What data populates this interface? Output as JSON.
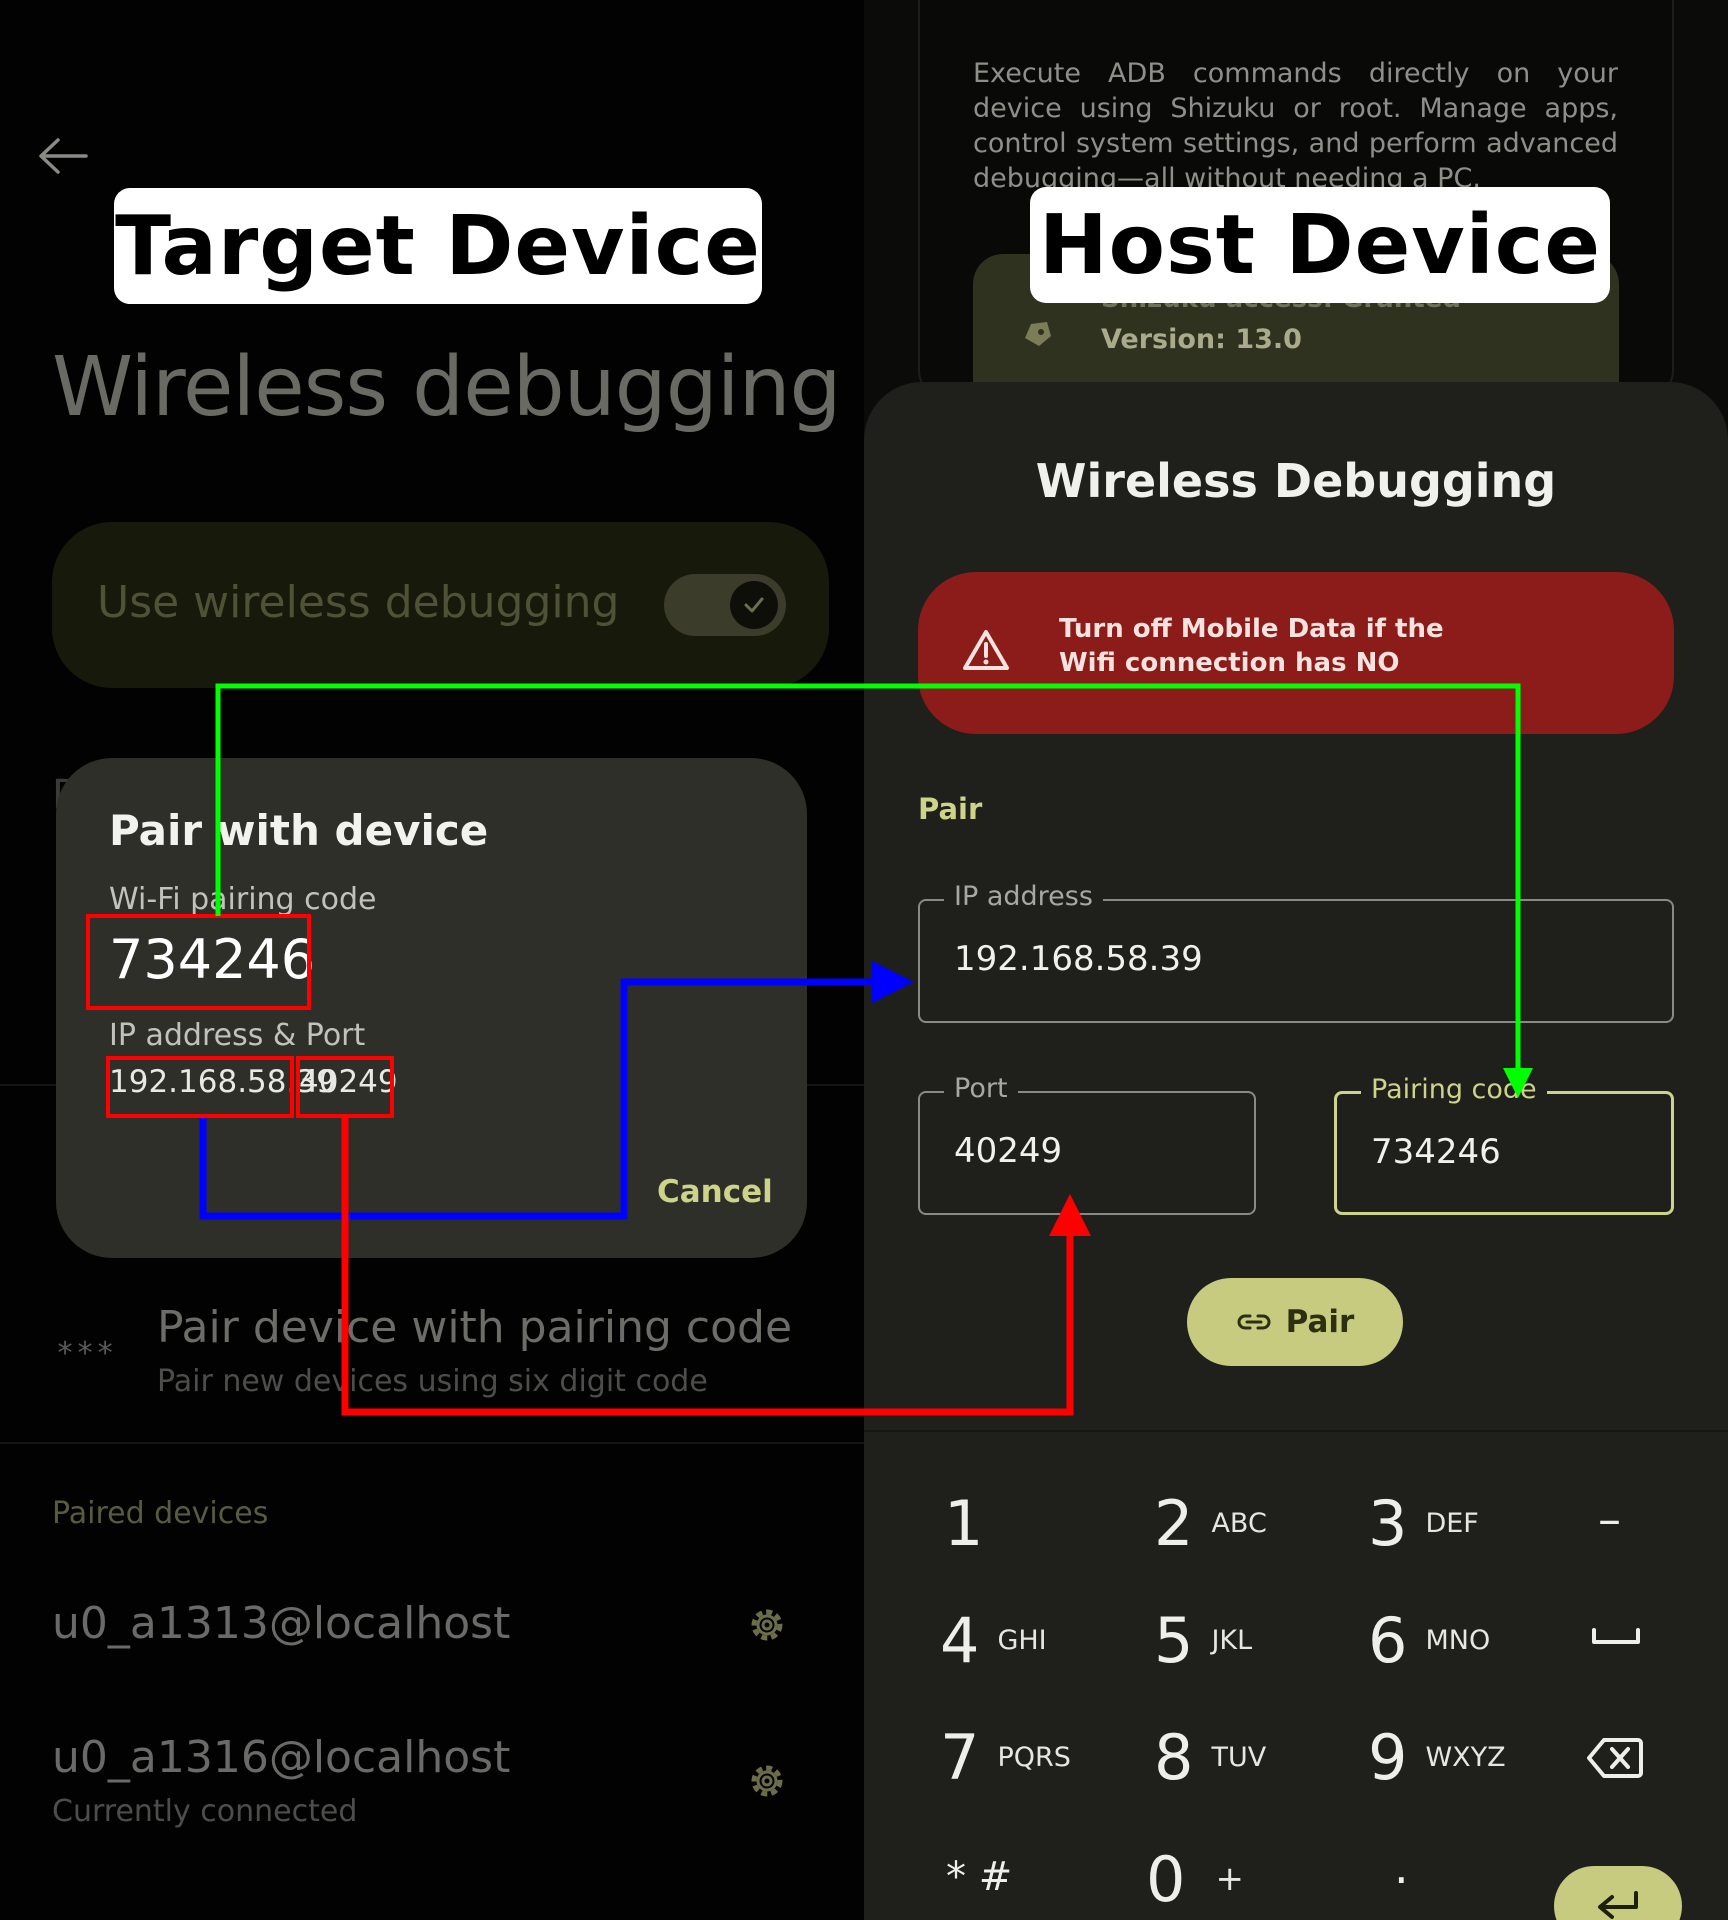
{
  "target": {
    "label": "Target Device",
    "page_title": "Wireless debugging",
    "toggle_label": "Use wireless debugging",
    "toggle_state": "on",
    "dialog": {
      "title": "Pair with device",
      "code_label": "Wi-Fi pairing code",
      "code": "734246",
      "ip_label": "IP address & Port",
      "ip": "192.168.58.39",
      "port": "40249",
      "cancel": "Cancel"
    },
    "pair_row": {
      "icon": "***",
      "title": "Pair device with pairing code",
      "subtitle": "Pair new devices using six digit code"
    },
    "paired_header": "Paired devices",
    "devices": [
      {
        "name": "u0_a1313@localhost",
        "sub": ""
      },
      {
        "name": "u0_a1316@localhost",
        "sub": "Currently connected"
      }
    ],
    "icons": {
      "back": "back-arrow-icon",
      "gear": "gear-icon",
      "check": "check-icon"
    }
  },
  "host": {
    "label": "Host Device",
    "description": "Execute ADB commands directly on your device using Shizuku or root. Manage apps, control system settings, and perform advanced debugging—all without needing a PC.",
    "shizuku_status": "Shizuku access: Granted",
    "shizuku_version": "Version: 13.0",
    "sheet_title": "Wireless Debugging",
    "warning": "Turn off Mobile Data if the Wifi connection has NO INTERNET",
    "pair_section": "Pair",
    "fields": {
      "ip": {
        "label": "IP address",
        "value": "192.168.58.39"
      },
      "port": {
        "label": "Port",
        "value": "40249"
      },
      "code": {
        "label": "Pairing code",
        "value": "734246"
      }
    },
    "pair_button": "Pair",
    "keypad": {
      "keys": [
        {
          "num": "1",
          "letters": ""
        },
        {
          "num": "2",
          "letters": "ABC"
        },
        {
          "num": "3",
          "letters": "DEF"
        },
        {
          "num": "4",
          "letters": "GHI"
        },
        {
          "num": "5",
          "letters": "JKL"
        },
        {
          "num": "6",
          "letters": "MNO"
        },
        {
          "num": "7",
          "letters": "PQRS"
        },
        {
          "num": "8",
          "letters": "TUV"
        },
        {
          "num": "9",
          "letters": "WXYZ"
        },
        {
          "num": "0",
          "letters": "+"
        }
      ],
      "minus": "–",
      "star_hash": "* #",
      "dot": "."
    },
    "colors": {
      "accent": "#cdd389",
      "warning_bg": "#8c1c1a",
      "sheet_bg": "#1f1f1b"
    }
  },
  "annotations": {
    "colors": {
      "pairing_code_arrow": "#00ff00",
      "ip_arrow": "#0000ff",
      "port_arrow": "#ff0000",
      "highlight_box": "#ff0000"
    }
  }
}
